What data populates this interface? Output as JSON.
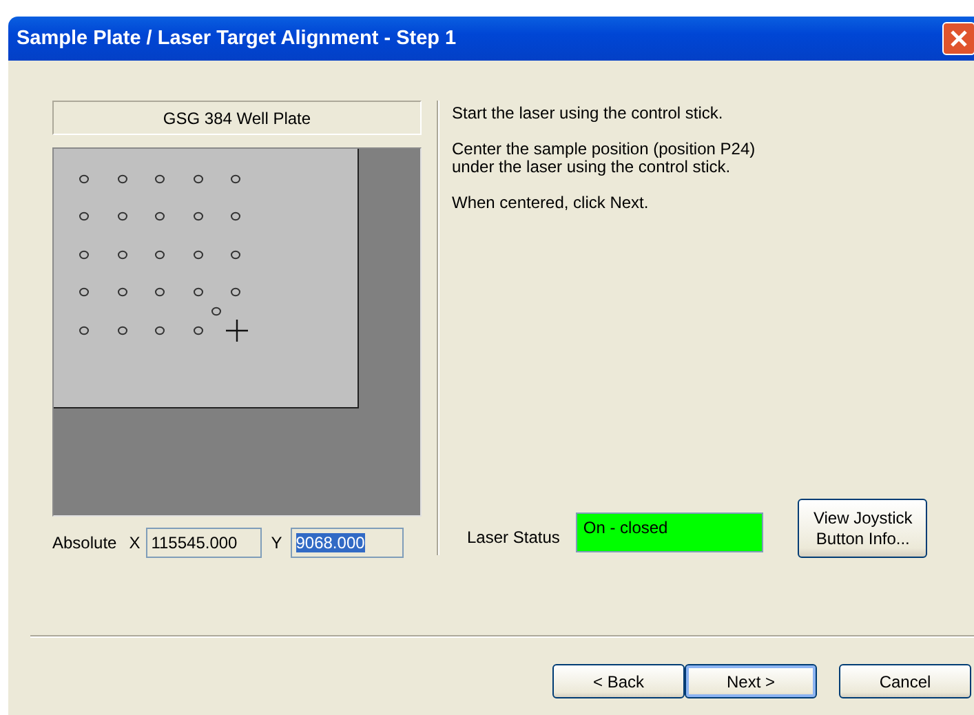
{
  "window": {
    "title": "Sample Plate / Laser Target Alignment - Step 1"
  },
  "plate": {
    "name": "GSG 384 Well Plate"
  },
  "position": {
    "label": "Absolute",
    "x_label": "X",
    "x_value": "115545.000",
    "y_label": "Y",
    "y_value": "9068.000",
    "y_selected": true
  },
  "instructions": [
    "Start the laser using the control stick.",
    "Center the sample position (position P24)\nunder the laser using the control stick.",
    "When centered, click Next."
  ],
  "laser_status": {
    "label": "Laser Status",
    "value": "On - closed"
  },
  "joystick_button": "View Joystick\nButton Info...",
  "buttons": [
    {
      "label": "< Back",
      "default": false
    },
    {
      "label": "Next >",
      "default": true
    },
    {
      "label": "Cancel",
      "default": false
    }
  ]
}
